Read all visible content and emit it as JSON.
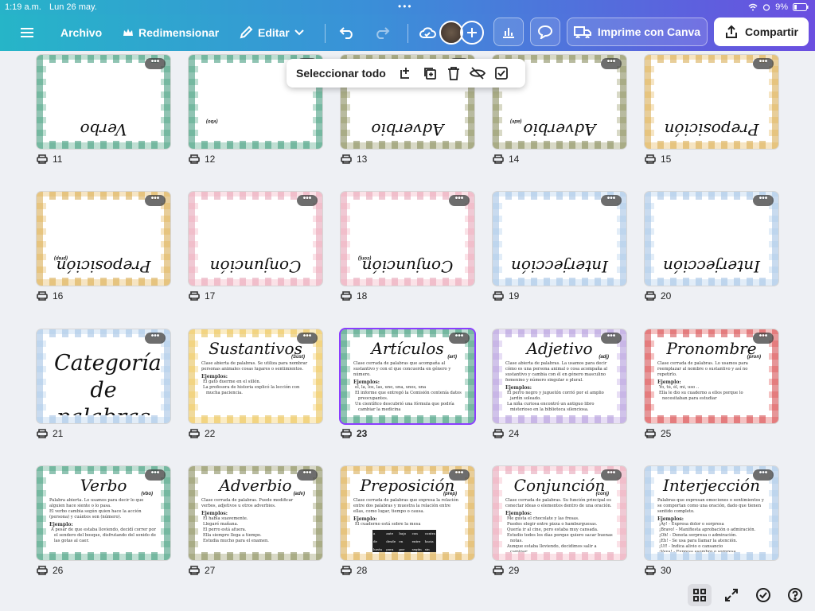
{
  "status": {
    "time": "1:19 a.m.",
    "date": "Lun 26 may.",
    "battery": "9%"
  },
  "topbar": {
    "file": "Archivo",
    "resize": "Redimensionar",
    "edit": "Editar",
    "print": "Imprime con Canva",
    "share": "Compartir"
  },
  "selection": {
    "label": "Seleccionar todo"
  },
  "colors": {
    "accent": "#8b3dff",
    "green": "#3e9e7a",
    "olive": "#8a8c55",
    "pink": "#f2a7b8",
    "blue": "#a9c9ea",
    "yellow": "#f3c64e",
    "purple": "#b79ce0",
    "red": "#e04848",
    "mixed": "#e3b04a"
  },
  "slides": [
    {
      "n": "11",
      "title": "Verbo",
      "sub": "",
      "theme": "green",
      "rot": true,
      "lines": [],
      "example": ""
    },
    {
      "n": "12",
      "title": "",
      "sub": "(vbo)",
      "theme": "green",
      "rot": true,
      "lines": [],
      "example": ""
    },
    {
      "n": "13",
      "title": "Adverbio",
      "sub": "",
      "theme": "olive",
      "rot": true,
      "lines": [],
      "example": ""
    },
    {
      "n": "14",
      "title": "Adverbio",
      "sub": "(adv)",
      "theme": "olive",
      "rot": true,
      "lines": [],
      "example": ""
    },
    {
      "n": "15",
      "title": "Preposición",
      "sub": "",
      "theme": "mixed",
      "rot": true,
      "lines": [],
      "example": ""
    },
    {
      "n": "16",
      "title": "Preposición",
      "sub": "(prep)",
      "theme": "mixed",
      "rot": true,
      "lines": [],
      "example": ""
    },
    {
      "n": "17",
      "title": "Conjunción",
      "sub": "",
      "theme": "pink",
      "rot": true,
      "lines": [],
      "example": ""
    },
    {
      "n": "18",
      "title": "Conjunción",
      "sub": "(conj)",
      "theme": "pink",
      "rot": true,
      "lines": [],
      "example": ""
    },
    {
      "n": "19",
      "title": "Interjección",
      "sub": "",
      "theme": "blue",
      "rot": true,
      "lines": [],
      "example": ""
    },
    {
      "n": "20",
      "title": "Interjección",
      "sub": "",
      "theme": "blue",
      "rot": true,
      "lines": [],
      "example": ""
    },
    {
      "n": "21",
      "title": "",
      "big": "Categorías de palabras",
      "theme": "blue",
      "rot": false,
      "lines": [],
      "example": ""
    },
    {
      "n": "22",
      "title": "Sustantivos",
      "sub": "(Sust)",
      "theme": "yellow",
      "rot": false,
      "lines": [
        "Clase abierta de palabras. Se utiliza para nombrar personas animales cosas lugares o sentimientos."
      ],
      "example": "Ejemplos:",
      "items": [
        "El gato duerme en el sillón.",
        "La profesora de historia explicó la lección con mucha paciencia."
      ]
    },
    {
      "n": "23",
      "title": "Artículos",
      "sub": "(art)",
      "theme": "green",
      "rot": false,
      "lines": [
        "Clase cerrada de palabras que acompaña al sustantivo y con el que concuerda en género y número."
      ],
      "example": "Ejemplos:",
      "items": [
        "el, la, los, las, uno, una, unos, una",
        "El informe que entregó la Comisión contenía datos preocupantes.",
        "Un científico descubrió una fórmula que podría cambiar la medicina"
      ]
    },
    {
      "n": "24",
      "title": "Adjetivo",
      "sub": "(adj)",
      "theme": "purple",
      "rot": false,
      "lines": [
        "Clase abierta de palabras. La usamos para decir cómo es una persona animal o cosa acompaña al sustantivo y cambia con él en género masculino femenino y número singular o plural."
      ],
      "example": "Ejemplos:",
      "items": [
        "El perro negro y juguetón corrió por el amplio jardín soleado.",
        "La niña curiosa encontró un antiguo libro misterioso en la biblioteca silenciosa."
      ]
    },
    {
      "n": "25",
      "title": "Pronombre",
      "sub": "(pron)",
      "theme": "red",
      "rot": false,
      "lines": [
        "Clase cerrada de palabras. Lo usamos para reemplazar al nombre o sustantivo y así no repetirlo."
      ],
      "example": "Ejemplo:",
      "items": [
        "Yo, tú, él, mi, uso ..",
        "Ella le dio su cuaderno a ellos porque lo necesitaban para estudiar"
      ]
    },
    {
      "n": "26",
      "title": "Verbo",
      "sub": "(vbo)",
      "theme": "green",
      "rot": false,
      "lines": [
        "Palabra abierta. Lo usamos para decir lo que alguien hace siente o lo pasa.",
        "El verbo cambia según quien hace la acción (persona) y cuántos son (número)."
      ],
      "example": "Ejemplo:",
      "items": [
        "A pesar de que estaba lloviendo, decidí correr por el sendero del bosque, disfrutando del sonido de las gotas al caer."
      ]
    },
    {
      "n": "27",
      "title": "Adverbio",
      "sub": "(adv)",
      "theme": "olive",
      "rot": false,
      "lines": [
        "Clase cerrada de palabras. Puede modificar verbos, adjetivos u otros adverbios."
      ],
      "example": "Ejemplos:",
      "items": [
        "El habla suavemente.",
        "Llegaré mañana.",
        "El perro está afuera.",
        "Ella siempre llega a tiempo.",
        "Estudia mucho para el examen."
      ]
    },
    {
      "n": "28",
      "title": "Preposición",
      "sub": "(prep)",
      "theme": "mixed",
      "rot": false,
      "lines": [
        "Clase cerrada de palabras que expresa la relación entre dos palabras y muestra la relación entre ellas, como lugar, tiempo o causa."
      ],
      "example": "Ejemplo:",
      "items": [
        "El cuaderno está sobre la mesa"
      ],
      "table": [
        "a",
        "ante",
        "bajo",
        "con",
        "contra",
        "de",
        "desde",
        "en",
        "entre",
        "hacia",
        "hasta",
        "para",
        "por",
        "según",
        "sin",
        "sobre",
        "tras",
        "",
        "",
        ""
      ]
    },
    {
      "n": "29",
      "title": "Conjunción",
      "sub": "(conj)",
      "theme": "pink",
      "rot": false,
      "lines": [
        "Clase cerrada de palabras. Su función principal es conectar ideas o elementos dentro de una oración."
      ],
      "example": "Ejemplos:",
      "items": [
        "Me gusta el chocolate y las fresas.",
        "Puedes elegir entre pizza o hamburguesas.",
        "Quería ir al cine, pero estaba muy cansada.",
        "Estudio todos los días porque quiero sacar buenas notas.",
        "Aunque estaba lloviendo, decidimos salir a caminar."
      ]
    },
    {
      "n": "30",
      "title": "Interjección",
      "sub": "",
      "theme": "blue",
      "rot": false,
      "lines": [
        "Palabras que expresan emociones o sentimientos y se comportan como una oración, dado que tienen sentido completo."
      ],
      "example": "Ejemplos:",
      "items": [
        "¡Ay! - Expresa dolor o sorpresa",
        "¡Bravo! - Manifiesta aprobación o admiración.",
        "¡Oh! - Denota sorpresa o admiración.",
        "¡Eh! - Se usa para llamar la atención.",
        "¡Uf! - Indica alivio o cansancio",
        "¡Vaya! - Expresa asombro o sorpresa."
      ]
    }
  ]
}
